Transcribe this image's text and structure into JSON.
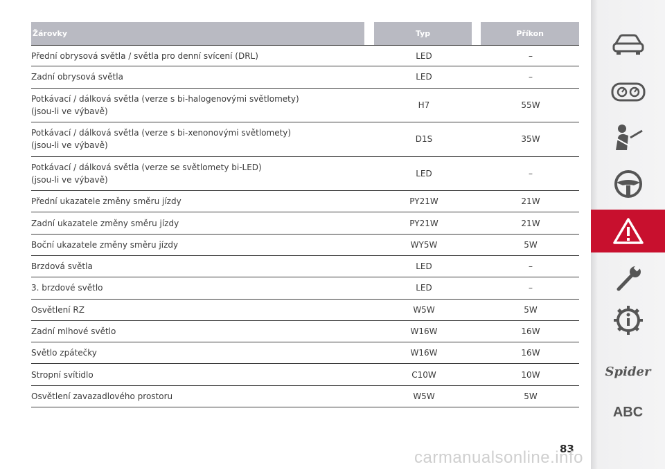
{
  "table": {
    "headers": {
      "name": "Žárovky",
      "type": "Typ",
      "power": "Příkon"
    },
    "rows": [
      {
        "name": "Přední obrysová světla / světla pro denní svícení (DRL)",
        "type": "LED",
        "power": "–"
      },
      {
        "name": "Zadní obrysová světla",
        "type": "LED",
        "power": "–"
      },
      {
        "name": "Potkávací / dálková světla (verze s bi-halogenovými světlomety)\n(jsou-li ve výbavě)",
        "type": "H7",
        "power": "55W"
      },
      {
        "name": "Potkávací / dálková světla (verze s bi-xenonovými světlomety)\n(jsou-li ve výbavě)",
        "type": "D1S",
        "power": "35W"
      },
      {
        "name": "Potkávací / dálková světla (verze se světlomety bi-LED)\n(jsou-li ve výbavě)",
        "type": "LED",
        "power": "–"
      },
      {
        "name": "Přední ukazatele změny směru jízdy",
        "type": "PY21W",
        "power": "21W"
      },
      {
        "name": "Zadní ukazatele změny směru jízdy",
        "type": "PY21W",
        "power": "21W"
      },
      {
        "name": "Boční ukazatele změny směru jízdy",
        "type": "WY5W",
        "power": "5W"
      },
      {
        "name": "Brzdová světla",
        "type": "LED",
        "power": "–"
      },
      {
        "name": "3. brzdové světlo",
        "type": "LED",
        "power": "–"
      },
      {
        "name": "Osvětlení RZ",
        "type": "W5W",
        "power": "5W"
      },
      {
        "name": "Zadní mlhové světlo",
        "type": "W16W",
        "power": "16W"
      },
      {
        "name": "Světlo zpátečky",
        "type": "W16W",
        "power": "16W"
      },
      {
        "name": "Stropní svítidlo",
        "type": "C10W",
        "power": "10W"
      },
      {
        "name": "Osvětlení zavazadlového prostoru",
        "type": "W5W",
        "power": "5W"
      }
    ]
  },
  "page_number": "83",
  "sidebar": {
    "items": [
      {
        "icon": "car-icon"
      },
      {
        "icon": "dashboard-gauges-icon"
      },
      {
        "icon": "seatbelt-passenger-icon"
      },
      {
        "icon": "steering-wheel-icon"
      },
      {
        "icon": "warning-triangle-icon",
        "active": true,
        "color": "#c8102e"
      },
      {
        "icon": "wrench-icon"
      },
      {
        "icon": "info-gear-icon"
      },
      {
        "label": "Spider"
      },
      {
        "label": "ABC"
      }
    ]
  },
  "watermark": "carmanualsonline.info"
}
